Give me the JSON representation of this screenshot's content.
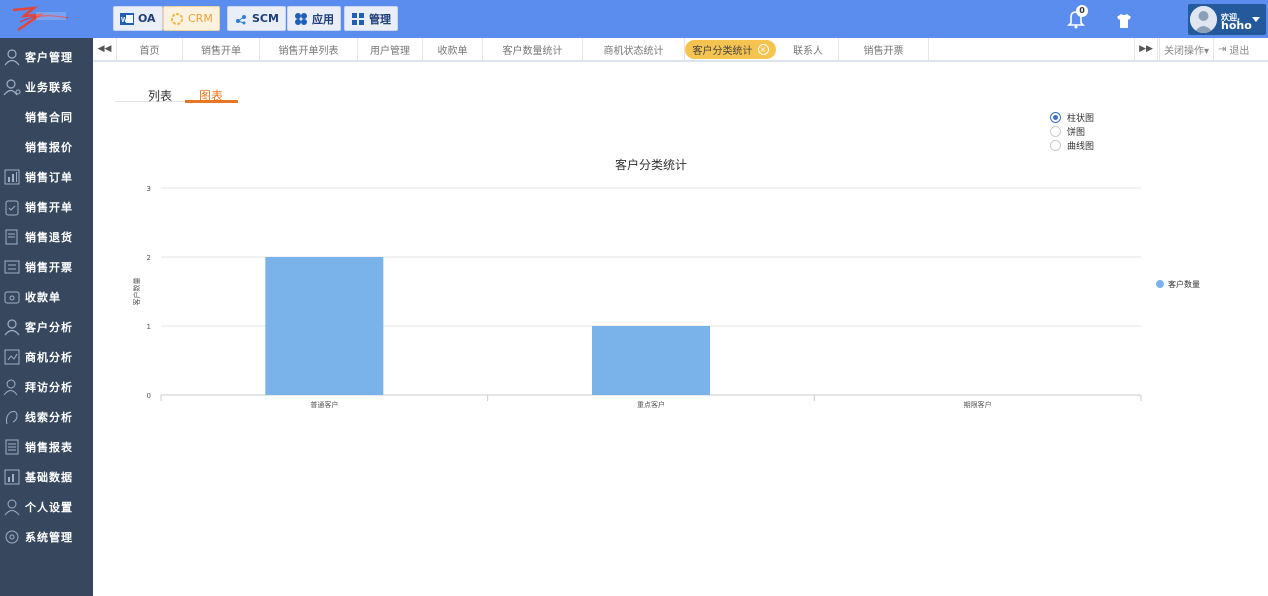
{
  "logo": {
    "text": ""
  },
  "top_modules": [
    {
      "label": "OA",
      "icon": "word-doc-icon"
    },
    {
      "label": "CRM",
      "icon": "crm-ring-icon"
    },
    {
      "label": "SCM",
      "icon": "scm-network-icon"
    },
    {
      "label": "应用",
      "icon": "apps-grid-icon"
    },
    {
      "label": "管理",
      "icon": "manage-grid-icon"
    }
  ],
  "notifications": {
    "count": "0"
  },
  "user": {
    "welcome": "欢迎,",
    "name": "hoho"
  },
  "sidebar": {
    "items": [
      {
        "label": "客户管理",
        "icon": "user-icon"
      },
      {
        "label": "业务联系",
        "icon": "user-contact-icon"
      },
      {
        "label": "销售合同",
        "icon": ""
      },
      {
        "label": "销售报价",
        "icon": ""
      },
      {
        "label": "销售订单",
        "icon": "bar-chart-icon"
      },
      {
        "label": "销售开单",
        "icon": "clipboard-icon"
      },
      {
        "label": "销售退货",
        "icon": "return-doc-icon"
      },
      {
        "label": "销售开票",
        "icon": "invoice-list-icon"
      },
      {
        "label": "收款单",
        "icon": "cash-icon"
      },
      {
        "label": "客户分析",
        "icon": "user-analysis-icon"
      },
      {
        "label": "商机分析",
        "icon": "opportunity-icon"
      },
      {
        "label": "拜访分析",
        "icon": "visit-icon"
      },
      {
        "label": "线索分析",
        "icon": "clue-icon"
      },
      {
        "label": "销售报表",
        "icon": "report-icon"
      },
      {
        "label": "基础数据",
        "icon": "data-icon"
      },
      {
        "label": "个人设置",
        "icon": "person-icon"
      },
      {
        "label": "系统管理",
        "icon": "settings-icon"
      }
    ]
  },
  "tabs": {
    "items": [
      {
        "label": "首页"
      },
      {
        "label": "销售开单"
      },
      {
        "label": "销售开单列表"
      },
      {
        "label": "用户管理"
      },
      {
        "label": "收款单"
      },
      {
        "label": "客户数量统计"
      },
      {
        "label": "商机状态统计"
      },
      {
        "label": "客户分类统计",
        "active": true
      },
      {
        "label": "联系人"
      },
      {
        "label": "销售开票"
      }
    ],
    "close_ops": "关闭操作▾",
    "logout": "退出"
  },
  "view_tabs": {
    "list": "列表",
    "chart": "图表"
  },
  "chart_type_options": [
    {
      "label": "柱状图",
      "selected": true
    },
    {
      "label": "饼图",
      "selected": false
    },
    {
      "label": "曲线图",
      "selected": false
    }
  ],
  "chart_data": {
    "type": "bar",
    "title": "客户分类统计",
    "ylabel": "客户数量",
    "xlabel": "",
    "categories": [
      "普通客户",
      "重点客户",
      "期限客户"
    ],
    "series": [
      {
        "name": "客户数量",
        "values": [
          2,
          1,
          0
        ]
      }
    ],
    "ylim": [
      0,
      3
    ],
    "yticks": [
      0,
      1,
      2,
      3
    ],
    "grid": true,
    "legend": "right",
    "bar_color": "#7ab3e9"
  }
}
